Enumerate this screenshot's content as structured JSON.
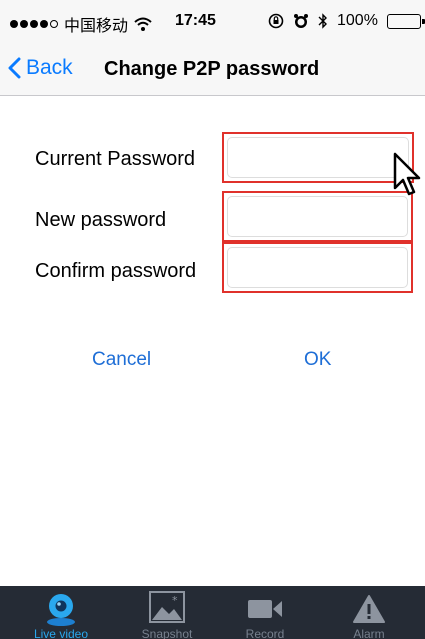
{
  "status_bar": {
    "carrier": "中国移动",
    "time": "17:45",
    "battery": "100%",
    "battery_level": 1.0,
    "icons": [
      "signal-dots-icon",
      "wifi-icon",
      "rotation-lock-icon",
      "alarm-icon",
      "bluetooth-icon",
      "battery-icon",
      "charging-bolt-icon"
    ]
  },
  "nav": {
    "back_label": "Back",
    "title": "Change P2P password",
    "accent": "#0a7bff"
  },
  "form": {
    "current_label": "Current Password",
    "current_value": "",
    "new_label": "New password",
    "new_value": "",
    "confirm_label": "Confirm password",
    "confirm_value": "",
    "highlight_color": "#e0312b"
  },
  "actions": {
    "cancel": "Cancel",
    "ok": "OK"
  },
  "tabs": [
    {
      "label": "Live video",
      "icon": "camera-icon",
      "active": true
    },
    {
      "label": "Snapshot",
      "icon": "image-icon",
      "active": false
    },
    {
      "label": "Record",
      "icon": "video-icon",
      "active": false
    },
    {
      "label": "Alarm",
      "icon": "warning-icon",
      "active": false
    }
  ],
  "tabbar_color": "#252b35"
}
